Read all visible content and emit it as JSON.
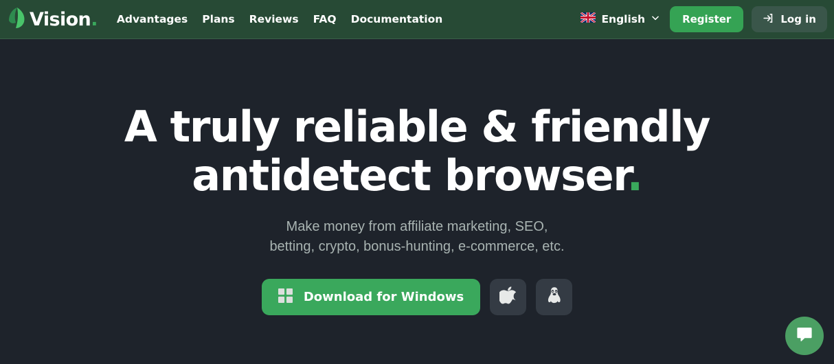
{
  "header": {
    "brand": {
      "name": "Vision",
      "dot": ".",
      "logo_icon": "leaf-logo-icon"
    },
    "nav": [
      {
        "label": "Advantages",
        "name": "nav-link-advantages"
      },
      {
        "label": "Plans",
        "name": "nav-link-plans"
      },
      {
        "label": "Reviews",
        "name": "nav-link-reviews"
      },
      {
        "label": "FAQ",
        "name": "nav-link-faq"
      },
      {
        "label": "Documentation",
        "name": "nav-link-documentation"
      }
    ],
    "language": {
      "label": "English",
      "flag_icon": "uk-flag-icon",
      "chevron_icon": "chevron-down-icon"
    },
    "register_label": "Register",
    "login_label": "Log in",
    "login_icon": "login-arrow-icon"
  },
  "hero": {
    "headline_line1": "A truly reliable & friendly",
    "headline_line2": "antidetect browser",
    "headline_accent": ".",
    "subtitle_line1": "Make money from affiliate marketing, SEO,",
    "subtitle_line2": "betting, crypto, bonus-hunting, e-commerce, etc.",
    "download_label": "Download for Windows",
    "windows_icon": "windows-icon",
    "apple_icon": "apple-icon",
    "linux_icon": "linux-penguin-icon"
  },
  "chat": {
    "icon": "chat-bubble-icon"
  },
  "colors": {
    "header_bg": "#274a35",
    "accent_green": "#3aa85c",
    "register_green": "#35a354",
    "dark_navy": "#1e232b",
    "login_btn": "#3a564a",
    "os_btn": "#343b44",
    "subtitle_text": "#a9b4b2",
    "chat_green": "#4b9f63"
  }
}
